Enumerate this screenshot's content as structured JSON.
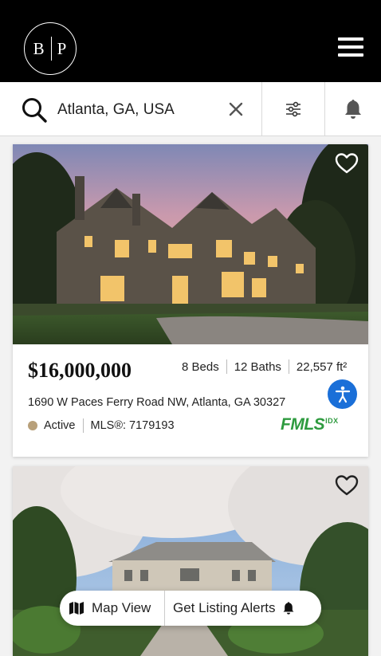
{
  "header": {
    "logo_left": "B",
    "logo_right": "P",
    "menu_icon": "hamburger-icon"
  },
  "search": {
    "value": "Atlanta, GA, USA",
    "icons": {
      "search": "search-icon",
      "clear": "close-icon",
      "filter": "sliders-icon",
      "alerts": "bell-icon"
    }
  },
  "listings": [
    {
      "price": "$16,000,000",
      "beds": "8 Beds",
      "baths": "12 Baths",
      "area": "22,557 ft²",
      "address": "1690 W Paces Ferry Road NW, Atlanta, GA 30327",
      "status": "Active",
      "mls": "MLS®: 7179193",
      "source_logo": "FMLS",
      "source_logo_sup": "IDX"
    }
  ],
  "floating_bar": {
    "map_label": "Map View",
    "alerts_label": "Get Listing Alerts"
  },
  "colors": {
    "header_bg": "#000000",
    "status_dot": "#b8a07a",
    "accessibility": "#1a6fd8",
    "fmls_green": "#2e9b3f"
  }
}
